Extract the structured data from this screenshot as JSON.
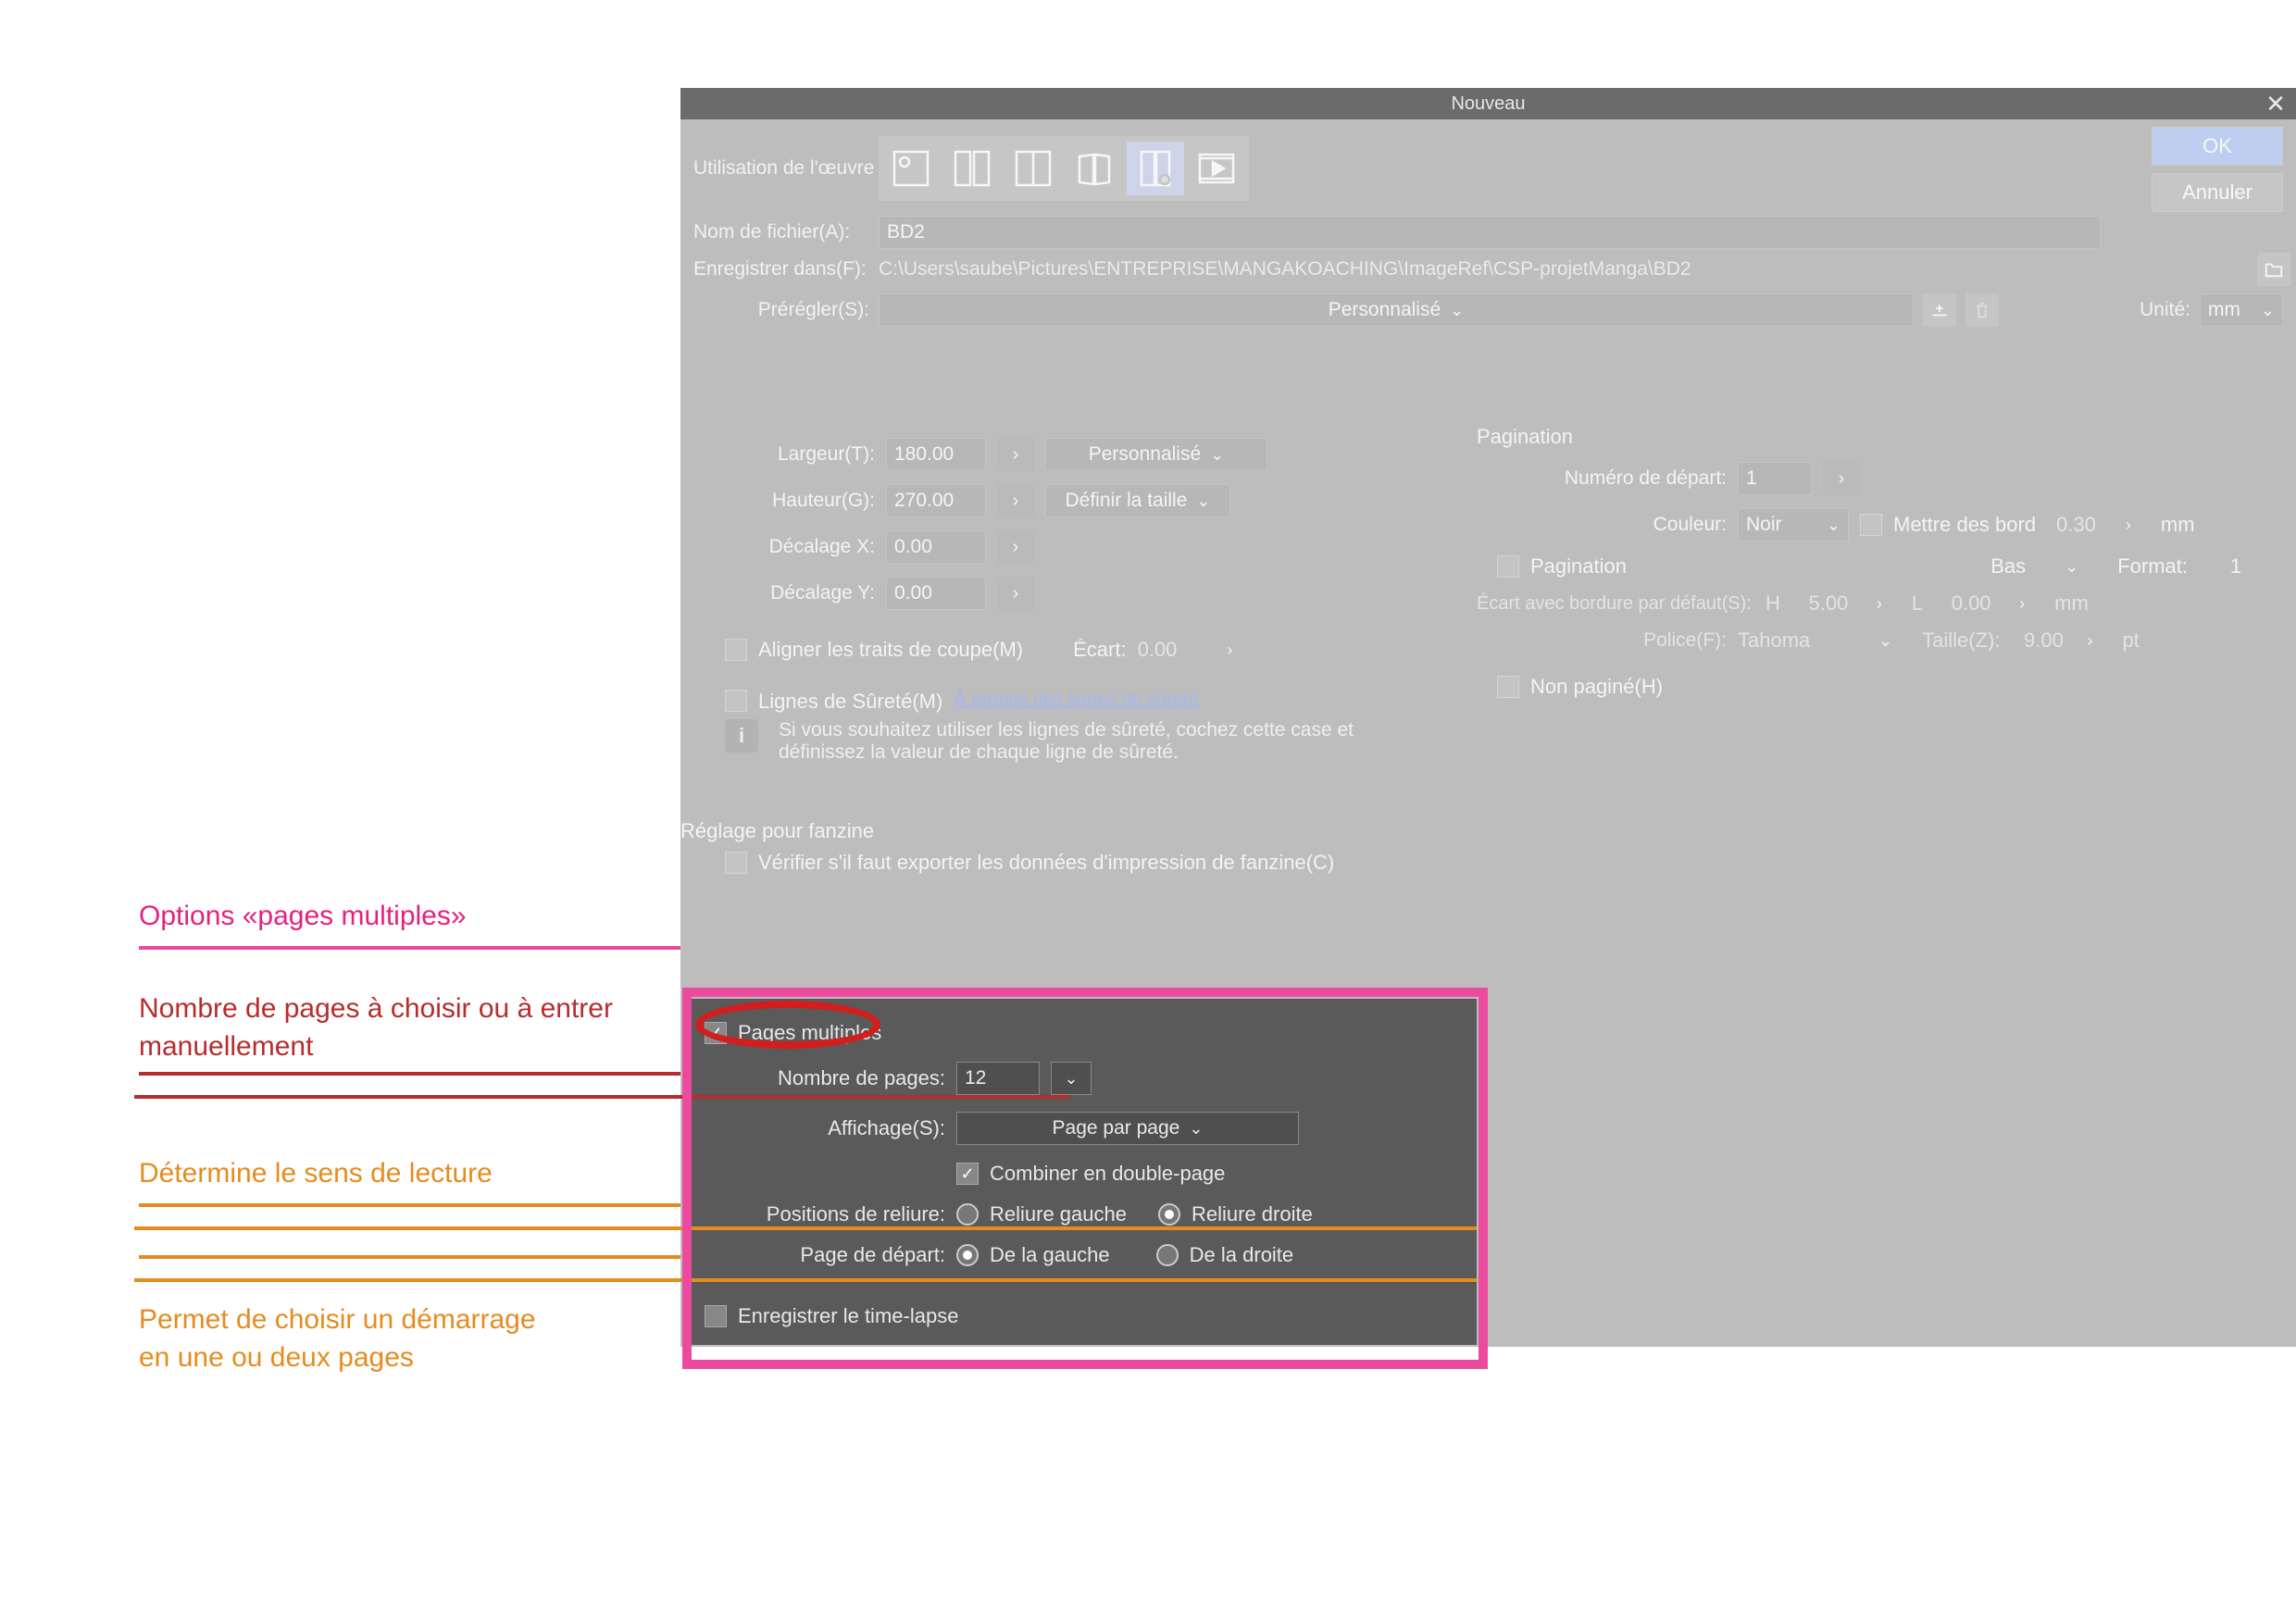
{
  "dialog": {
    "title": "Nouveau",
    "buttons": {
      "ok": "OK",
      "cancel": "Annuler"
    },
    "usage_label": "Utilisation de l'œuvre",
    "filename_label": "Nom de fichier(A):",
    "filename_value": "BD2",
    "savein_label": "Enregistrer dans(F):",
    "savein_value": "C:\\Users\\saube\\Pictures\\ENTREPRISE\\MANGAKOACHING\\ImageRef\\CSP-projetManga\\BD2",
    "preset_label": "Prérégler(S):",
    "preset_value": "Personnalisé",
    "unit_label": "Unité:",
    "unit_value": "mm"
  },
  "left": {
    "width_label": "Largeur(T):",
    "width_value": "180.00",
    "width_preset": "Personnalisé",
    "height_label": "Hauteur(G):",
    "height_value": "270.00",
    "define_size": "Définir la taille",
    "offx_label": "Décalage X:",
    "offx_value": "0.00",
    "offy_label": "Décalage Y:",
    "offy_value": "0.00",
    "align_crop_label": "Aligner les traits de coupe(M)",
    "gap_label": "Écart:",
    "gap_value": "0.00",
    "safety_label": "Lignes de Sûreté(M)",
    "safety_link": "À propos des lignes de sûreté",
    "safety_info": "Si vous souhaitez utiliser les lignes de sûreté, cochez cette case et définissez la valeur de chaque ligne de sûreté.",
    "fanzine_title": "Réglage pour fanzine",
    "fanzine_check": "Vérifier s'il faut exporter les données d'impression de fanzine(C)"
  },
  "right": {
    "pagination_title": "Pagination",
    "start_num_label": "Numéro de départ:",
    "start_num_value": "1",
    "color_label": "Couleur:",
    "color_value": "Noir",
    "border_label": "Mettre des bord",
    "border_value": "0.30",
    "border_unit": "mm",
    "pagination_chk": "Pagination",
    "pagination_pos": "Bas",
    "format_label": "Format:",
    "format_value": "1",
    "default_border_gap": "Écart avec bordure par défaut(S):",
    "h_label": "H",
    "h_value": "5.00",
    "l_label": "L",
    "l_value": "0.00",
    "l_unit": "mm",
    "font_label": "Police(F):",
    "font_value": "Tahoma",
    "size_label": "Taille(Z):",
    "size_value": "9.00",
    "size_unit": "pt",
    "not_paginated": "Non paginé(H)"
  },
  "multipage": {
    "label": "Pages multiples",
    "pages_label": "Nombre de pages:",
    "pages_value": "12",
    "display_label": "Affichage(S):",
    "display_value": "Page par page",
    "combine_label": "Combiner en double-page",
    "binding_label": "Positions de reliure:",
    "binding_left": "Reliure gauche",
    "binding_right": "Reliure droite",
    "start_label": "Page de départ:",
    "start_left": "De la gauche",
    "start_right": "De la droite",
    "timelapse": "Enregistrer le time-lapse"
  },
  "annotations": {
    "a1": "Options «pages multiples»",
    "a2": "Nombre de pages à choisir ou à entrer manuellement",
    "a3": "Détermine le sens de lecture",
    "a4": "Permet de choisir un démarrage en une ou deux pages"
  }
}
